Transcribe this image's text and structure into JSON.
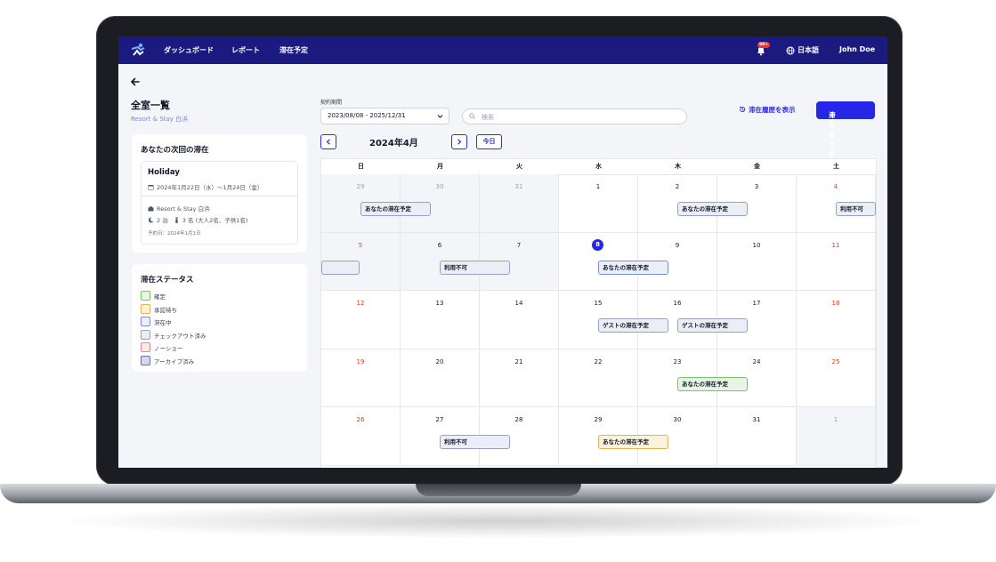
{
  "nav": {
    "items": [
      "ダッシュボード",
      "レポート",
      "滞在予定"
    ],
    "badge": "99+",
    "language": "日本語",
    "user": "John Doe"
  },
  "page": {
    "title": "全室一覧",
    "subtitle": "Resort & Stay 白浜"
  },
  "next_stay": {
    "title": "あなたの次回の滞在",
    "name": "Holiday",
    "dates": "2024年1月22日（水）〜1月24日（金）",
    "property": "Resort & Stay 白浜",
    "nights": "2 泊",
    "guests": "3 名 (大人2名、子供1名)",
    "booked": "予約日：2024年1月1日"
  },
  "status": {
    "title": "滞在ステータス",
    "items": [
      {
        "label": "確定",
        "color": "#e7f5e4",
        "border": "#7ac36a"
      },
      {
        "label": "承認待ち",
        "color": "#fdf3dc",
        "border": "#e6b352"
      },
      {
        "label": "滞在中",
        "color": "#eaf0fb",
        "border": "#7c8fd6"
      },
      {
        "label": "チェックアウト済み",
        "color": "#eceef6",
        "border": "#9aa0c4"
      },
      {
        "label": "ノーショー",
        "color": "#fde8e8",
        "border": "#e38b8b"
      },
      {
        "label": "アーカイブ済み",
        "color": "#d6d9ea",
        "border": "#6b70a3"
      }
    ]
  },
  "controls": {
    "period_label": "契約期間",
    "period_value": "2023/08/08 - 2025/12/31",
    "search_placeholder": "検索",
    "history_label": "滞在履歴を表示",
    "reserve_label": "滞在を予約",
    "month": "2024年4月",
    "today": "今日"
  },
  "calendar": {
    "weekdays": [
      "日",
      "月",
      "火",
      "水",
      "木",
      "金",
      "土"
    ],
    "weeks": [
      [
        {
          "d": "29",
          "s": "gray",
          "m": true
        },
        {
          "d": "30",
          "s": "gray",
          "m": true
        },
        {
          "d": "31",
          "s": "gray",
          "m": true
        },
        {
          "d": "1"
        },
        {
          "d": "2"
        },
        {
          "d": "3"
        },
        {
          "d": "4",
          "s": "red"
        }
      ],
      [
        {
          "d": "5",
          "s": "red",
          "m": true
        },
        {
          "d": "6",
          "m": true
        },
        {
          "d": "7",
          "m": true
        },
        {
          "d": "8",
          "s": "cur"
        },
        {
          "d": "9"
        },
        {
          "d": "10"
        },
        {
          "d": "11",
          "s": "red"
        }
      ],
      [
        {
          "d": "12",
          "s": "red"
        },
        {
          "d": "13"
        },
        {
          "d": "14"
        },
        {
          "d": "15"
        },
        {
          "d": "16"
        },
        {
          "d": "17"
        },
        {
          "d": "18",
          "s": "red"
        }
      ],
      [
        {
          "d": "19",
          "s": "red"
        },
        {
          "d": "20"
        },
        {
          "d": "21"
        },
        {
          "d": "22"
        },
        {
          "d": "23"
        },
        {
          "d": "24"
        },
        {
          "d": "25",
          "s": "red"
        }
      ],
      [
        {
          "d": "26",
          "s": "red"
        },
        {
          "d": "27"
        },
        {
          "d": "28"
        },
        {
          "d": "29"
        },
        {
          "d": "30"
        },
        {
          "d": "31"
        },
        {
          "d": "1",
          "s": "gray",
          "m": true
        }
      ]
    ],
    "events": [
      {
        "label": "あなたの滞在予定",
        "week": 0,
        "day": 0,
        "span": 1,
        "status": "checkedout"
      },
      {
        "label": "あなたの滞在予定",
        "week": 0,
        "day": 4,
        "span": 1,
        "status": "checkedout"
      },
      {
        "label": "利用不可",
        "week": 0,
        "day": 6,
        "span": 1,
        "status": "checkedout"
      },
      {
        "label": "",
        "week": 1,
        "day": 0,
        "span": 0.5,
        "status": "checkedout"
      },
      {
        "label": "利用不可",
        "week": 1,
        "day": 1,
        "span": 1,
        "status": "checkedout"
      },
      {
        "label": "あなたの滞在予定",
        "week": 1,
        "day": 3,
        "span": 1,
        "status": "staying"
      },
      {
        "label": "ゲストの滞在予定",
        "week": 2,
        "day": 3,
        "span": 1,
        "status": "checkedout"
      },
      {
        "label": "ゲストの滞在予定",
        "week": 2,
        "day": 4,
        "span": 1,
        "status": "checkedout"
      },
      {
        "label": "あなたの滞在予定",
        "week": 3,
        "day": 4,
        "span": 1,
        "status": "confirmed"
      },
      {
        "label": "利用不可",
        "week": 4,
        "day": 1,
        "span": 1,
        "status": "checkedout"
      },
      {
        "label": "あなたの滞在予定",
        "week": 4,
        "day": 3,
        "span": 1,
        "status": "pending"
      }
    ]
  }
}
